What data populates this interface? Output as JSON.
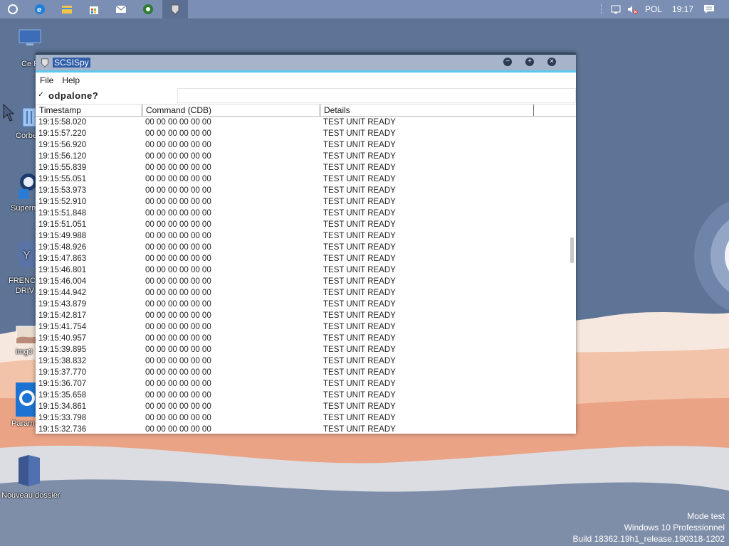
{
  "taskbar": {
    "apps": [
      {
        "name": "cortana-icon"
      },
      {
        "name": "edge-icon"
      },
      {
        "name": "file-explorer-icon"
      },
      {
        "name": "store-icon"
      },
      {
        "name": "mail-icon"
      },
      {
        "name": "app-green-icon"
      },
      {
        "name": "scsispy-taskbar-icon",
        "active": true
      }
    ],
    "tray": {
      "language": "POL",
      "clock": "19:17"
    }
  },
  "desktop": {
    "icons": [
      {
        "label": "Ce P",
        "icon": "this-pc-icon"
      },
      {
        "label": "Corbe",
        "icon": "recycle-bin-icon"
      },
      {
        "label": "Superm",
        "icon": "superman-icon"
      },
      {
        "label": "FRENCH\nDRIV",
        "icon": "driver-icon"
      },
      {
        "label": "img0",
        "icon": "image-file-icon"
      },
      {
        "label": "Param",
        "icon": "settings-icon"
      },
      {
        "label": "Nouveau dossier",
        "icon": "folder-icon"
      }
    ],
    "watermark": {
      "line1": "Mode test",
      "line2": "Windows 10 Professionnel",
      "line3": "Build 18362.19h1_release.190318-1202"
    }
  },
  "window": {
    "title": "SCSISpy",
    "controls": {
      "minimize": "−",
      "maximize": "+",
      "close": "×"
    },
    "menu": [
      "File",
      "Help"
    ],
    "filter": {
      "checked": true,
      "label": "odpalone?",
      "value": ""
    },
    "columns": [
      "Timestamp",
      "Command (CDB)",
      "Details"
    ],
    "rows": [
      [
        "19:15:58.020",
        "00 00 00 00 00 00",
        "TEST UNIT READY"
      ],
      [
        "19:15:57.220",
        "00 00 00 00 00 00",
        "TEST UNIT READY"
      ],
      [
        "19:15:56.920",
        "00 00 00 00 00 00",
        "TEST UNIT READY"
      ],
      [
        "19:15:56.120",
        "00 00 00 00 00 00",
        "TEST UNIT READY"
      ],
      [
        "19:15:55.839",
        "00 00 00 00 00 00",
        "TEST UNIT READY"
      ],
      [
        "19:15:55.051",
        "00 00 00 00 00 00",
        "TEST UNIT READY"
      ],
      [
        "19:15:53.973",
        "00 00 00 00 00 00",
        "TEST UNIT READY"
      ],
      [
        "19:15:52.910",
        "00 00 00 00 00 00",
        "TEST UNIT READY"
      ],
      [
        "19:15:51.848",
        "00 00 00 00 00 00",
        "TEST UNIT READY"
      ],
      [
        "19:15:51.051",
        "00 00 00 00 00 00",
        "TEST UNIT READY"
      ],
      [
        "19:15:49.988",
        "00 00 00 00 00 00",
        "TEST UNIT READY"
      ],
      [
        "19:15:48.926",
        "00 00 00 00 00 00",
        "TEST UNIT READY"
      ],
      [
        "19:15:47.863",
        "00 00 00 00 00 00",
        "TEST UNIT READY"
      ],
      [
        "19:15:46.801",
        "00 00 00 00 00 00",
        "TEST UNIT READY"
      ],
      [
        "19:15:46.004",
        "00 00 00 00 00 00",
        "TEST UNIT READY"
      ],
      [
        "19:15:44.942",
        "00 00 00 00 00 00",
        "TEST UNIT READY"
      ],
      [
        "19:15:43.879",
        "00 00 00 00 00 00",
        "TEST UNIT READY"
      ],
      [
        "19:15:42.817",
        "00 00 00 00 00 00",
        "TEST UNIT READY"
      ],
      [
        "19:15:41.754",
        "00 00 00 00 00 00",
        "TEST UNIT READY"
      ],
      [
        "19:15:40.957",
        "00 00 00 00 00 00",
        "TEST UNIT READY"
      ],
      [
        "19:15:39.895",
        "00 00 00 00 00 00",
        "TEST UNIT READY"
      ],
      [
        "19:15:38.832",
        "00 00 00 00 00 00",
        "TEST UNIT READY"
      ],
      [
        "19:15:37.770",
        "00 00 00 00 00 00",
        "TEST UNIT READY"
      ],
      [
        "19:15:36.707",
        "00 00 00 00 00 00",
        "TEST UNIT READY"
      ],
      [
        "19:15:35.658",
        "00 00 00 00 00 00",
        "TEST UNIT READY"
      ],
      [
        "19:15:34.861",
        "00 00 00 00 00 00",
        "TEST UNIT READY"
      ],
      [
        "19:15:33.798",
        "00 00 00 00 00 00",
        "TEST UNIT READY"
      ],
      [
        "19:15:32.736",
        "00 00 00 00 00 00",
        "TEST UNIT READY"
      ]
    ]
  },
  "colors": {
    "taskbar": "#7a8fb3",
    "desktop_top": "#5f7597",
    "accent": "#5bc8ee",
    "title_highlight": "#2f5da8"
  }
}
